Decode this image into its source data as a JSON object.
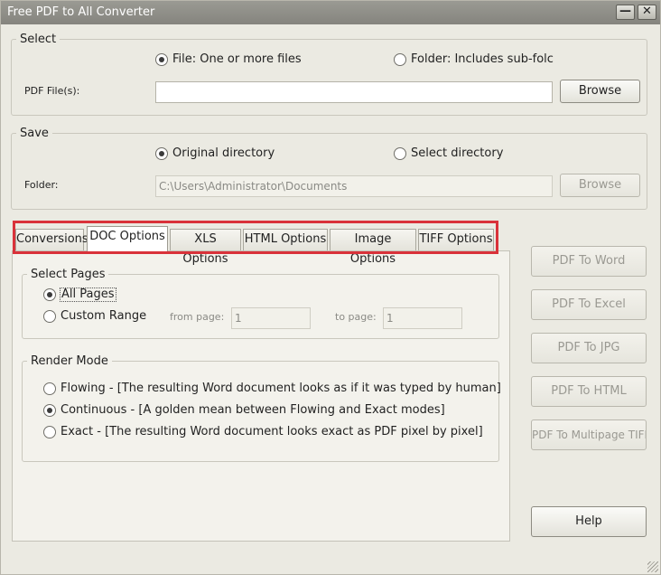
{
  "window": {
    "title": "Free PDF to All Converter",
    "minimize_label": "—",
    "close_label": "✕"
  },
  "select": {
    "legend": "Select",
    "file_option": "File:  One or more files",
    "folder_option": "Folder: Includes sub-folc",
    "pdf_label": "PDF File(s):",
    "pdf_value": "",
    "browse": "Browse"
  },
  "save": {
    "legend": "Save",
    "original_option": "Original directory",
    "select_option": "Select directory",
    "folder_label": "Folder:",
    "folder_value": "C:\\Users\\Administrator\\Documents",
    "browse": "Browse"
  },
  "tabs": [
    {
      "label": "Conversions"
    },
    {
      "label": "DOC Options"
    },
    {
      "label": "XLS Options"
    },
    {
      "label": "HTML Options"
    },
    {
      "label": "Image Options"
    },
    {
      "label": "TIFF Options"
    }
  ],
  "select_pages": {
    "legend": "Select Pages",
    "all_pages": "All Pages",
    "custom_range": "Custom Range",
    "from_label": "from page:",
    "from_value": "1",
    "to_label": "to page:",
    "to_value": "1"
  },
  "render_mode": {
    "legend": "Render Mode",
    "flowing": "Flowing - [The resulting Word document looks as if it was typed by human]",
    "continuous": "Continuous - [A golden mean between Flowing and Exact modes]",
    "exact": "Exact - [The resulting Word document looks exact as PDF pixel by pixel]"
  },
  "actions": {
    "to_word": "PDF To Word",
    "to_excel": "PDF To Excel",
    "to_jpg": "PDF To JPG",
    "to_html": "PDF To HTML",
    "to_tiff": "PDF To Multipage TIFF",
    "help": "Help"
  },
  "colors": {
    "highlight": "#d9323a",
    "background": "#ebeae2",
    "titlebar": "#8f8e88"
  }
}
